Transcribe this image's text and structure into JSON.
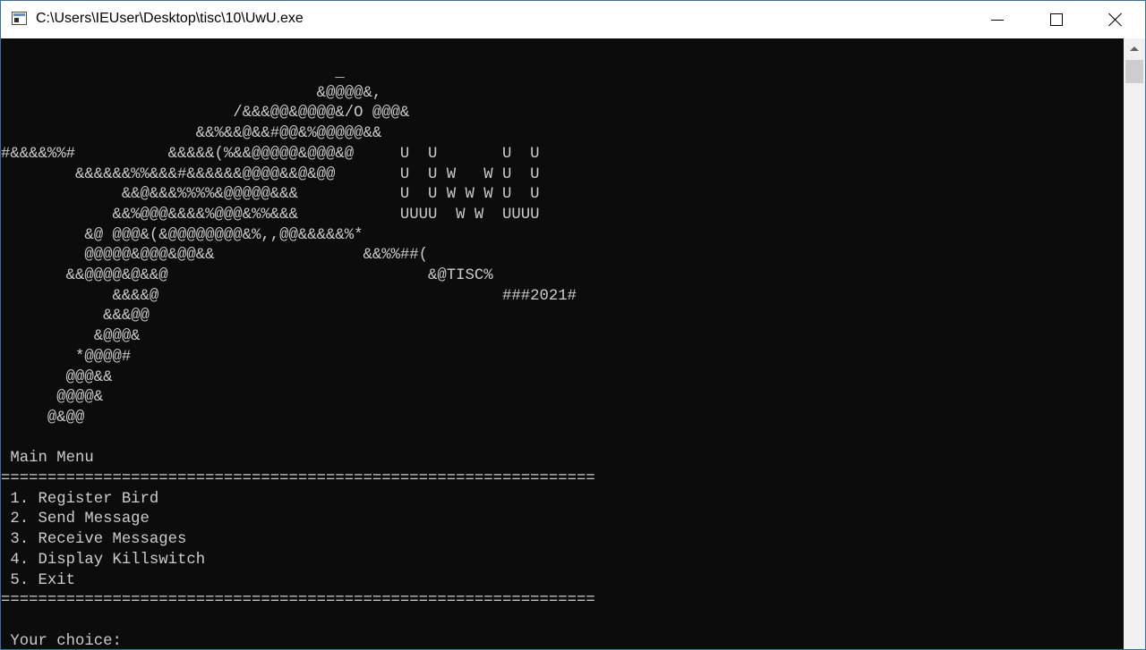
{
  "window": {
    "title": "C:\\Users\\IEUser\\Desktop\\tisc\\10\\UwU.exe"
  },
  "console": {
    "banner_lines": [
      "                                    _",
      "                                  &@@@@&,",
      "                         /&&&@@&@@@@&/O @@@&",
      "                     &&%&&@&&#@@&%@@@@@&&",
      "#&&&&%%#          &&&&&(%&&@@@@@&@@@&@     U  U       U  U",
      "        &&&&&&%%&&&#&&&&&&@@@@&&@&@@       U  U W   W U  U",
      "             &&@&&&%%%%&@@@@@&&&           U  U W W W U  U",
      "            &&%@@@&&&&%@@@&%%&&&           UUUU  W W  UUUU",
      "         &@ @@@&(&@@@@@@@@&%,,@@&&&&&%*",
      "         @@@@@&@@@&@@&&                &&%%##(",
      "       &&@@@@&@&&@                            &@TISC%",
      "            &&&&@                                     ###2021#",
      "           &&&@@",
      "          &@@@&",
      "        *@@@@#",
      "       @@@&&",
      "      @@@@&",
      "     @&@@"
    ],
    "menu_title": " Main Menu",
    "separator": "================================================================",
    "menu_items": [
      " 1. Register Bird",
      " 2. Send Message",
      " 3. Receive Messages",
      " 4. Display Killswitch",
      " 5. Exit"
    ],
    "prompt": " Your choice: "
  },
  "colors": {
    "console_bg": "#0c0c0c",
    "console_fg": "#cccccc",
    "titlebar_bg": "#ffffff"
  }
}
